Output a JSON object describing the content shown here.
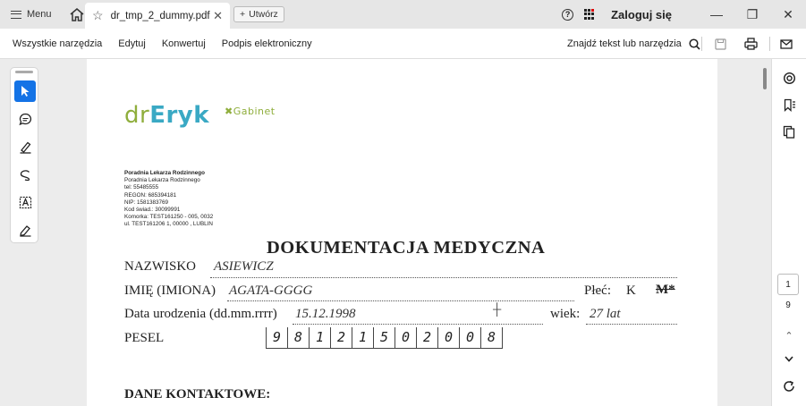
{
  "tabbar": {
    "menu_label": "Menu",
    "tab_title": "dr_tmp_2_dummy.pdf",
    "create_label": "Utwórz",
    "login_label": "Zaloguj się"
  },
  "toolbar": {
    "items": [
      "Wszystkie narzędzia",
      "Edytuj",
      "Konwertuj",
      "Podpis elektroniczny"
    ],
    "search_label": "Znajdź tekst lub narzędzia"
  },
  "pager": {
    "current": "1",
    "total": "9"
  },
  "document": {
    "logo_dr": "dr",
    "logo_eryk": "Eryk",
    "logo_gabinet": "✖Gabinet",
    "clinic_lines": [
      "Poradnia Lekarza Rodzinnego",
      "Poradnia Lekarza Rodzinnego",
      "tel: 55485555",
      "REGON: 685394181",
      "NIP: 1581383769",
      "Kod świad.: 30099991",
      "Komorka: TEST161250 - 005, 0032",
      "ul. TEST161206 1, 00000 , LUBLIN"
    ],
    "title": "DOKUMENTACJA MEDYCZNA",
    "surname_label": "NAZWISKO",
    "surname_value": "ASIEWICZ",
    "name_label": "IMIĘ (IMIONA)",
    "name_value": "AGATA-GGGG",
    "sex_label": "Płeć:",
    "sex_k": "K",
    "sex_m": "M*",
    "birth_label": "Data urodzenia (dd.mm.rrrr)",
    "birth_value": "15.12.1998",
    "age_label": "wiek:",
    "age_value": "27 lat",
    "pesel_label": "PESEL",
    "pesel_digits": [
      "9",
      "8",
      "1",
      "2",
      "1",
      "5",
      "0",
      "2",
      "0",
      "0",
      "8"
    ],
    "section_label": "DANE KONTAKTOWE:"
  }
}
